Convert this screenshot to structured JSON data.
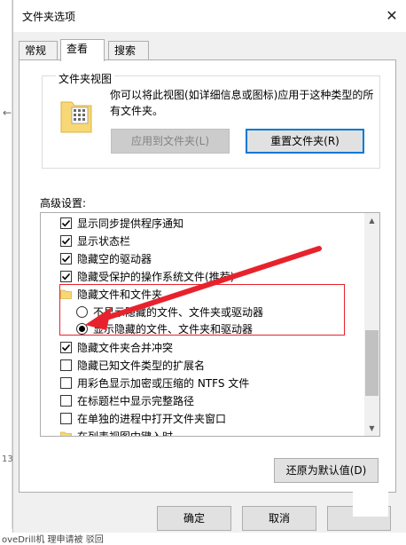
{
  "dialog": {
    "title": "文件夹选项",
    "close_glyph": "✕"
  },
  "tabs": [
    {
      "label": "常规",
      "active": false
    },
    {
      "label": "查看",
      "active": true
    },
    {
      "label": "搜索",
      "active": false
    }
  ],
  "folder_views": {
    "legend": "文件夹视图",
    "description": "你可以将此视图(如详细信息或图标)应用于这种类型的所有文件夹。",
    "apply_button": "应用到文件夹(L)",
    "reset_button": "重置文件夹(R)"
  },
  "advanced": {
    "label": "高级设置:",
    "items": [
      {
        "type": "checkbox",
        "checked": true,
        "label": "显示同步提供程序通知"
      },
      {
        "type": "checkbox",
        "checked": true,
        "label": "显示状态栏"
      },
      {
        "type": "checkbox",
        "checked": true,
        "label": "隐藏空的驱动器"
      },
      {
        "type": "checkbox",
        "checked": true,
        "label": "隐藏受保护的操作系统文件(推荐)"
      },
      {
        "type": "folder",
        "label": "隐藏文件和文件夹"
      },
      {
        "type": "radio",
        "checked": false,
        "label": "不显示隐藏的文件、文件夹或驱动器"
      },
      {
        "type": "radio",
        "checked": true,
        "label": "显示隐藏的文件、文件夹和驱动器"
      },
      {
        "type": "checkbox",
        "checked": true,
        "label": "隐藏文件夹合并冲突"
      },
      {
        "type": "checkbox",
        "checked": false,
        "label": "隐藏已知文件类型的扩展名"
      },
      {
        "type": "checkbox",
        "checked": false,
        "label": "用彩色显示加密或压缩的 NTFS 文件"
      },
      {
        "type": "checkbox",
        "checked": false,
        "label": "在标题栏中显示完整路径"
      },
      {
        "type": "checkbox",
        "checked": false,
        "label": "在单独的进程中打开文件夹窗口"
      },
      {
        "type": "folder",
        "label": "在列表视图中键入时"
      }
    ],
    "restore_button": "还原为默认值(D)"
  },
  "footer": {
    "ok_button": "确定",
    "cancel_button": "取消"
  },
  "background": {
    "left_arrow": "←",
    "left_number": "13",
    "bottom_text": "oveDrill机 理申请被 驳回"
  },
  "colors": {
    "highlight_box": "#e8222d",
    "arrow": "#e8222d",
    "focus_border": "#0078d7",
    "folder_yellow": "#f8d775"
  }
}
